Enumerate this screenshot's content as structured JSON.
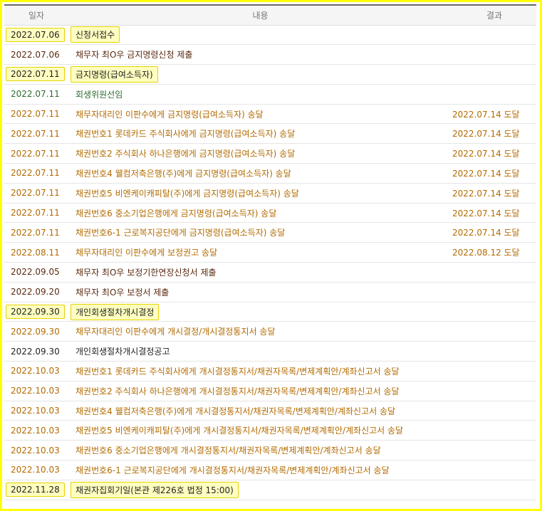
{
  "table": {
    "headers": {
      "date": "일자",
      "content": "내용",
      "result": "결과"
    },
    "rows": [
      {
        "date": "2022.07.06",
        "content": "신청서접수",
        "result": "",
        "color": "#222222",
        "highlight": true
      },
      {
        "date": "2022.07.06",
        "content": "채무자 최O우 금지명령신청 제출",
        "result": "",
        "color": "#5a2a10",
        "highlight": false
      },
      {
        "date": "2022.07.11",
        "content": "금지명령(급여소득자)",
        "result": "",
        "color": "#222222",
        "highlight": true
      },
      {
        "date": "2022.07.11",
        "content": "회생위원선임",
        "result": "",
        "color": "#2e6b2e",
        "highlight": false
      },
      {
        "date": "2022.07.11",
        "content": "채무자대리인 이판수에게 금지명령(급여소득자) 송달",
        "result": "2022.07.14 도달",
        "color": "#b36b00",
        "highlight": false
      },
      {
        "date": "2022.07.11",
        "content": "채권번호1 롯데카드 주식회사에게 금지명령(급여소득자) 송달",
        "result": "2022.07.14 도달",
        "color": "#b36b00",
        "highlight": false
      },
      {
        "date": "2022.07.11",
        "content": "채권번호2 주식회사 하나은행에게 금지명령(급여소득자) 송달",
        "result": "2022.07.14 도달",
        "color": "#b36b00",
        "highlight": false
      },
      {
        "date": "2022.07.11",
        "content": "채권번호4 웰컴저축은행(주)에게 금지명령(급여소득자) 송달",
        "result": "2022.07.14 도달",
        "color": "#b36b00",
        "highlight": false
      },
      {
        "date": "2022.07.11",
        "content": "채권번호5 비엔케이캐피탈(주)에게 금지명령(급여소득자) 송달",
        "result": "2022.07.14 도달",
        "color": "#b36b00",
        "highlight": false
      },
      {
        "date": "2022.07.11",
        "content": "채권번호6 중소기업은행에게 금지명령(급여소득자) 송달",
        "result": "2022.07.14 도달",
        "color": "#b36b00",
        "highlight": false
      },
      {
        "date": "2022.07.11",
        "content": "채권번호6-1 근로복지공단에게 금지명령(급여소득자) 송달",
        "result": "2022.07.14 도달",
        "color": "#b36b00",
        "highlight": false
      },
      {
        "date": "2022.08.11",
        "content": "채무자대리인 이판수에게 보정권고 송달",
        "result": "2022.08.12 도달",
        "color": "#b36b00",
        "highlight": false
      },
      {
        "date": "2022.09.05",
        "content": "채무자 최O우 보정기한연장신청서 제출",
        "result": "",
        "color": "#5a2a10",
        "highlight": false
      },
      {
        "date": "2022.09.20",
        "content": "채무자 최O우 보정서 제출",
        "result": "",
        "color": "#5a2a10",
        "highlight": false
      },
      {
        "date": "2022.09.30",
        "content": "개인회생절차개시결정",
        "result": "",
        "color": "#222222",
        "highlight": true
      },
      {
        "date": "2022.09.30",
        "content": "채무자대리인 이판수에게 개시결정/개시결정통지서 송달",
        "result": "",
        "color": "#b36b00",
        "highlight": false
      },
      {
        "date": "2022.09.30",
        "content": "개인회생절차개시결정공고",
        "result": "",
        "color": "#222222",
        "highlight": false
      },
      {
        "date": "2022.10.03",
        "content": "채권번호1 롯데카드 주식회사에게 개시결정통지서/채권자목록/변제계획안/계좌신고서 송달",
        "result": "",
        "color": "#b36b00",
        "highlight": false
      },
      {
        "date": "2022.10.03",
        "content": "채권번호2 주식회사 하나은행에게 개시결정통지서/채권자목록/변제계획안/계좌신고서 송달",
        "result": "",
        "color": "#b36b00",
        "highlight": false
      },
      {
        "date": "2022.10.03",
        "content": "채권번호4 웰컴저축은행(주)에게 개시결정통지서/채권자목록/변제계획안/계좌신고서 송달",
        "result": "",
        "color": "#b36b00",
        "highlight": false
      },
      {
        "date": "2022.10.03",
        "content": "채권번호5 비엔케이캐피탈(주)에게 개시결정통지서/채권자목록/변제계획안/계좌신고서 송달",
        "result": "",
        "color": "#b36b00",
        "highlight": false
      },
      {
        "date": "2022.10.03",
        "content": "채권번호6 중소기업은행에게 개시결정통지서/채권자목록/변제계획안/계좌신고서 송달",
        "result": "",
        "color": "#b36b00",
        "highlight": false
      },
      {
        "date": "2022.10.03",
        "content": "채권번호6-1 근로복지공단에게 개시결정통지서/채권자목록/변제계획안/계좌신고서 송달",
        "result": "",
        "color": "#b36b00",
        "highlight": false
      },
      {
        "date": "2022.11.28",
        "content": "채권자집회기일(본관 제226호 법정 15:00)",
        "result": "",
        "color": "#222222",
        "highlight": true
      }
    ]
  },
  "colors": {
    "highlight_bg": "#ffffc0",
    "highlight_border": "#e6d200",
    "frame": "#ffff00"
  }
}
